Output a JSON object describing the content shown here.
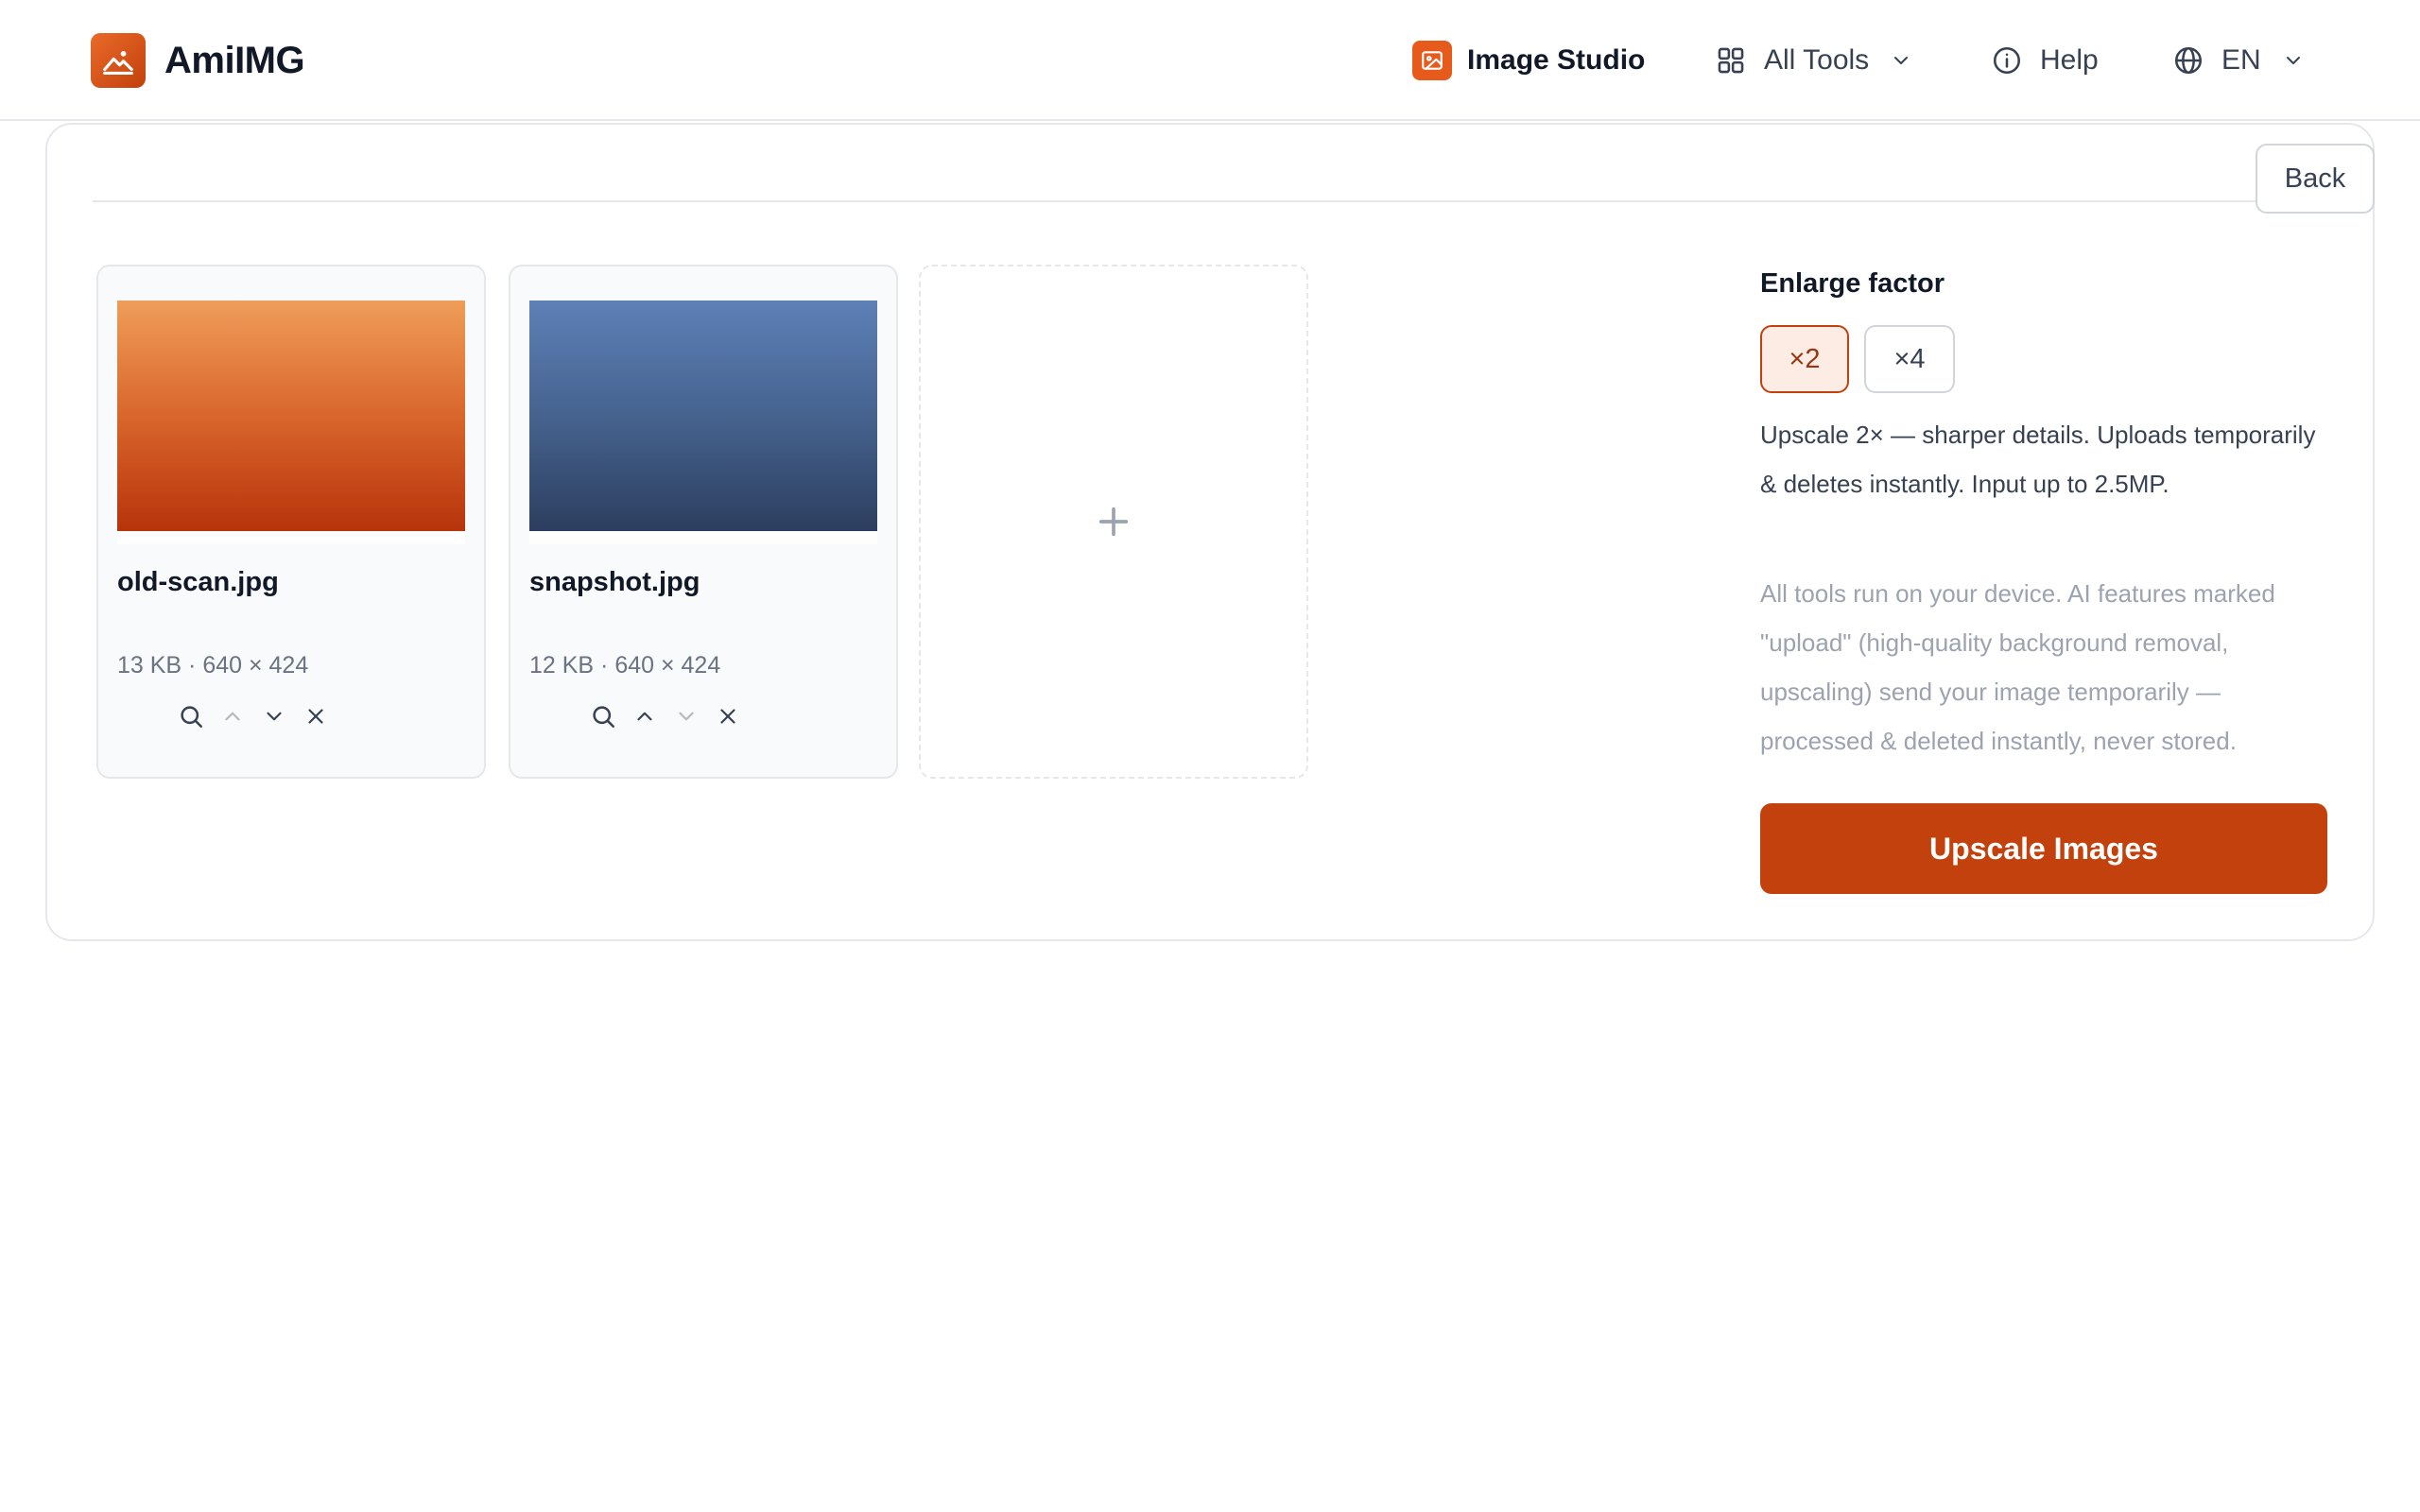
{
  "app": {
    "name": "AmiIMG",
    "logo_icon": "mountain-sun-icon",
    "accent_color": "#c2410c"
  },
  "nav": {
    "studio_label": "Image Studio",
    "tools_label": "All Tools",
    "help_label": "Help",
    "lang_label": "EN"
  },
  "toolbar": {
    "back_label": "Back"
  },
  "files": [
    {
      "name": "old-scan.jpg",
      "meta": "13 KB · 640 × 424",
      "thumb_color": "orange-gradient",
      "can_move_up": false,
      "can_move_down": true
    },
    {
      "name": "snapshot.jpg",
      "meta": "12 KB · 640 × 424",
      "thumb_color": "blue-gradient",
      "can_move_up": true,
      "can_move_down": false
    }
  ],
  "add_tile": {
    "icon": "plus-icon"
  },
  "settings": {
    "factor_label": "Enlarge factor",
    "options": [
      {
        "label": "×2",
        "selected": true
      },
      {
        "label": "×4",
        "selected": false
      }
    ],
    "description": "Upscale 2× — sharper details. Uploads temporarily & deletes instantly. Input up to 2.5MP.",
    "privacy_note": "All tools run on your device. AI features marked \"upload\" (high-quality background removal, upscaling) send your image temporarily — processed & deleted instantly, never stored.",
    "action_label": "Upscale Images"
  }
}
